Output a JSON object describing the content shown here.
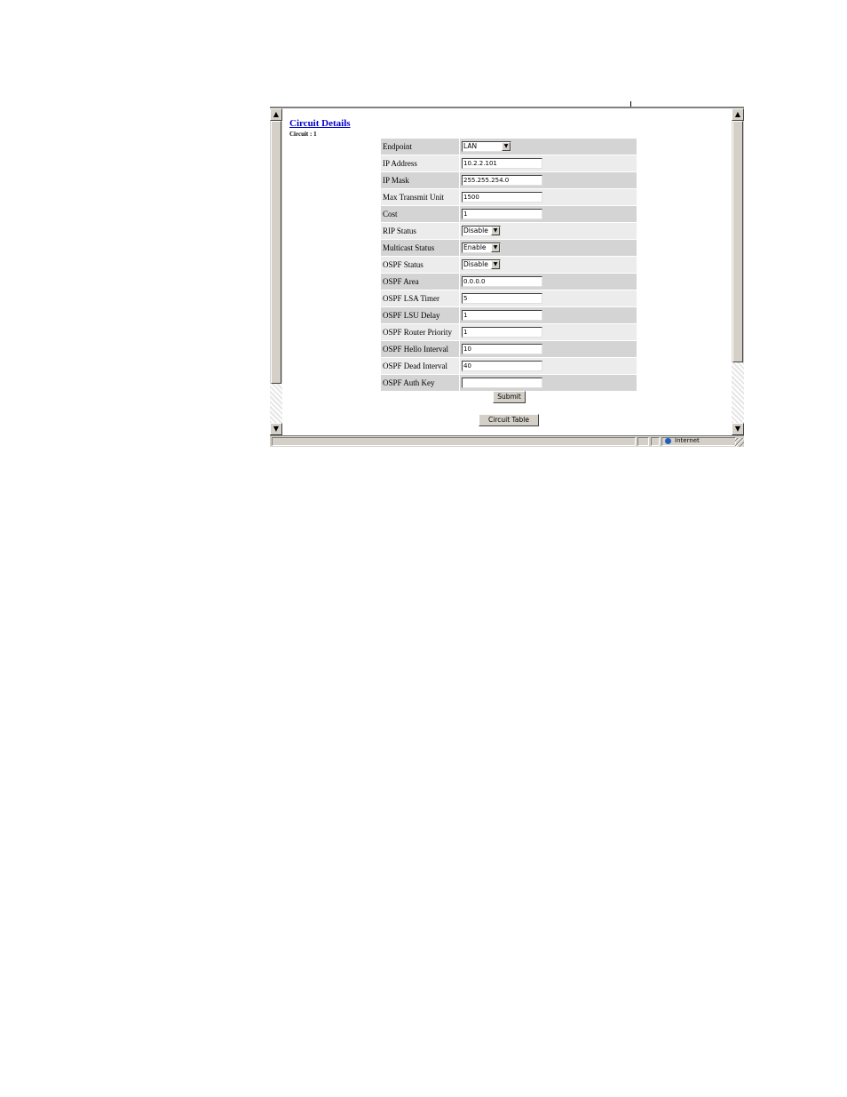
{
  "page": {
    "title": "Circuit Details",
    "subtitle": "Circuit : 1"
  },
  "form": {
    "rows": [
      {
        "label": "Endpoint",
        "type": "select",
        "value": "LAN"
      },
      {
        "label": "IP Address",
        "type": "text",
        "value": "10.2.2.101"
      },
      {
        "label": "IP Mask",
        "type": "text",
        "value": "255.255.254.0"
      },
      {
        "label": "Max Transmit Unit",
        "type": "text",
        "value": "1500"
      },
      {
        "label": "Cost",
        "type": "text",
        "value": "1"
      },
      {
        "label": "RIP Status",
        "type": "select",
        "value": "Disable"
      },
      {
        "label": "Multicast Status",
        "type": "select",
        "value": "Enable"
      },
      {
        "label": "OSPF Status",
        "type": "select",
        "value": "Disable"
      },
      {
        "label": "OSPF Area",
        "type": "text",
        "value": "0.0.0.0"
      },
      {
        "label": "OSPF LSA Timer",
        "type": "text",
        "value": "5"
      },
      {
        "label": "OSPF LSU Delay",
        "type": "text",
        "value": "1"
      },
      {
        "label": "OSPF Router Priority",
        "type": "text",
        "value": "1"
      },
      {
        "label": "OSPF Hello Interval",
        "type": "text",
        "value": "10"
      },
      {
        "label": "OSPF Dead Interval",
        "type": "text",
        "value": "40"
      },
      {
        "label": "OSPF Auth Key",
        "type": "text",
        "value": ""
      }
    ],
    "submit_label": "Submit",
    "circuit_table_label": "Circuit Table"
  },
  "statusbar": {
    "zone_label": "Internet"
  }
}
